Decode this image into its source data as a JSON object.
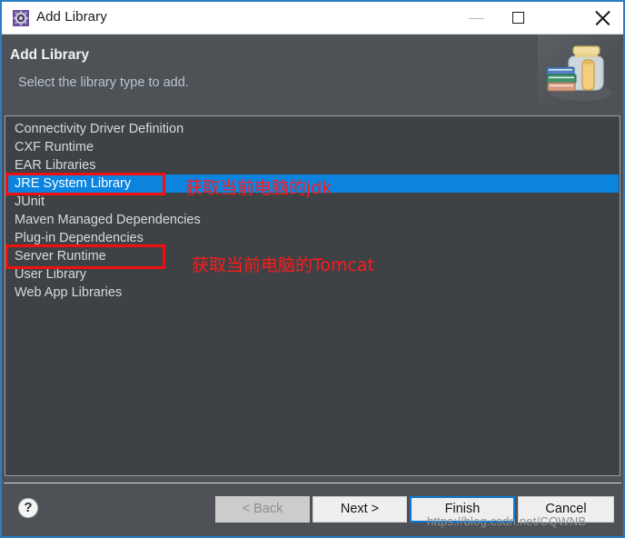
{
  "window": {
    "title": "Add Library",
    "title_icon": "eclipse-gear-icon",
    "controls": {
      "minimize": "minimize-icon",
      "maximize": "maximize-icon",
      "close": "close-icon"
    },
    "accent_border_color": "#2b7cc0",
    "body_background": "#4e5256"
  },
  "header": {
    "title": "Add Library",
    "subtitle": "Select the library type to add.",
    "art_icon": "books-jar-icon"
  },
  "library_list": {
    "background": "#3e4245",
    "selection_color": "#0b84e0",
    "items": [
      {
        "label": "Connectivity Driver Definition",
        "selected": false
      },
      {
        "label": "CXF Runtime",
        "selected": false
      },
      {
        "label": "EAR Libraries",
        "selected": false
      },
      {
        "label": "JRE System Library",
        "selected": true
      },
      {
        "label": "JUnit",
        "selected": false
      },
      {
        "label": "Maven Managed Dependencies",
        "selected": false
      },
      {
        "label": "Plug-in Dependencies",
        "selected": false
      },
      {
        "label": "Server Runtime",
        "selected": false
      },
      {
        "label": "User Library",
        "selected": false
      },
      {
        "label": "Web App Libraries",
        "selected": false
      }
    ]
  },
  "annotations": {
    "color": "#ff1a1a",
    "jdk_note": "获取当前电脑的jdk",
    "tomcat_note": "获取当前电脑的Tomcat",
    "box_jre_target": "JRE System Library",
    "box_server_target": "Server Runtime"
  },
  "footer": {
    "help_glyph": "?",
    "buttons": {
      "back": "< Back",
      "next": "Next >",
      "finish": "Finish",
      "cancel": "Cancel"
    },
    "focus_color": "#1078d0",
    "watermark": "https://blog.csdn.net/CQWNB"
  }
}
